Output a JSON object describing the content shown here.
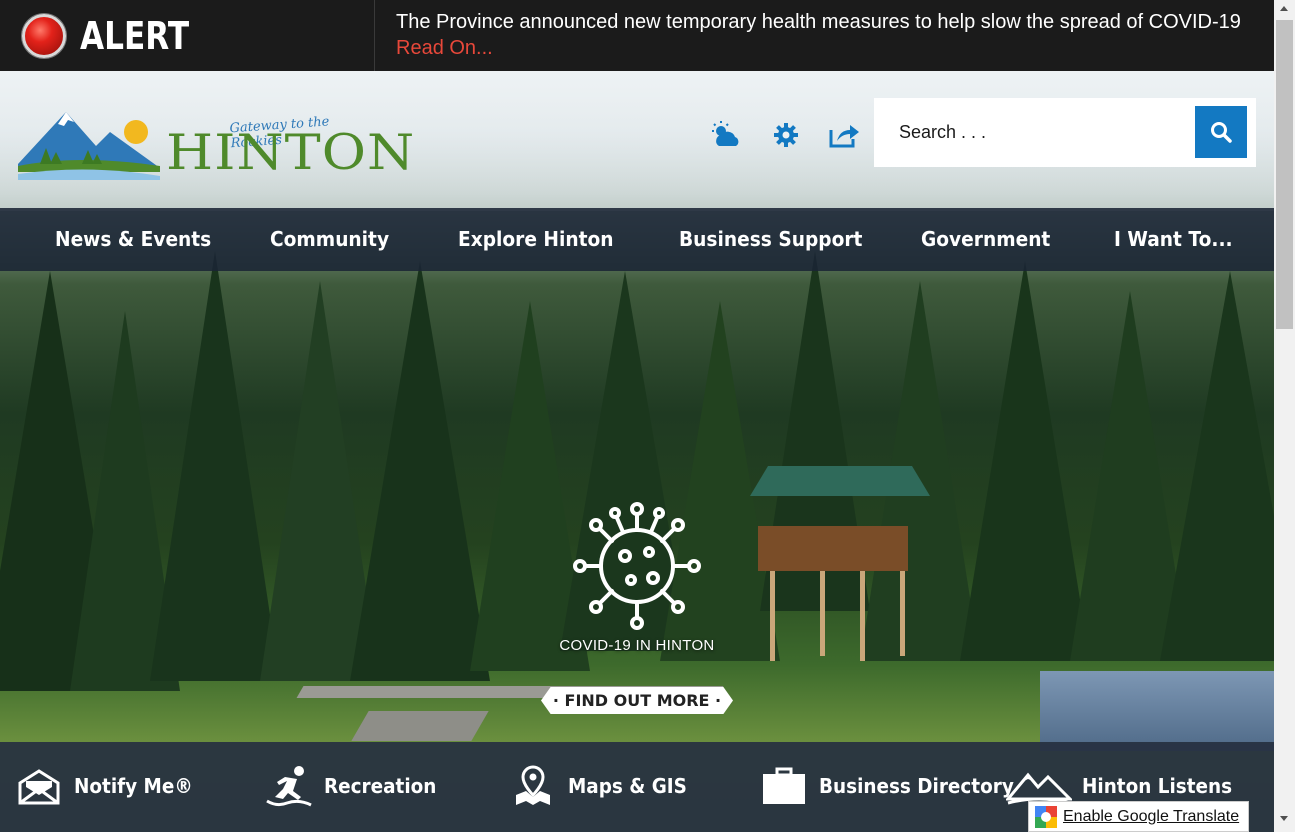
{
  "alert": {
    "label": "ALERT",
    "message": "The Province announced new temporary health measures to help slow the spread of COVID-19",
    "link_text": "Read On..."
  },
  "logo": {
    "word": "HINTON",
    "tagline": "Gateway to the Rockies"
  },
  "header_icons": [
    "weather-icon",
    "gear-icon",
    "share-icon"
  ],
  "search": {
    "placeholder": "Search . . .",
    "value": ""
  },
  "nav": {
    "items": [
      {
        "label": "News & Events"
      },
      {
        "label": "Community"
      },
      {
        "label": "Explore Hinton"
      },
      {
        "label": "Business Support"
      },
      {
        "label": "Government"
      },
      {
        "label": "I Want To..."
      }
    ]
  },
  "hero": {
    "caption": "COVID-19 IN HINTON",
    "button_label": "· FIND OUT MORE ·"
  },
  "quick_links": [
    {
      "label": "Notify Me®",
      "icon": "envelope-icon"
    },
    {
      "label": "Recreation",
      "icon": "runner-icon"
    },
    {
      "label": "Maps & GIS",
      "icon": "map-pin-icon"
    },
    {
      "label": "Business Directory",
      "icon": "briefcase-icon"
    },
    {
      "label": "Hinton Listens",
      "icon": "mountain-icon"
    }
  ],
  "translate": {
    "label": "Enable Google Translate"
  },
  "colors": {
    "alert_bg": "#1b1b1b",
    "alert_link": "#e8483a",
    "nav_bg": "#1a2434",
    "search_button": "#1379c2",
    "logo_green": "#4f8a2b",
    "logo_blue": "#2f79b8"
  }
}
